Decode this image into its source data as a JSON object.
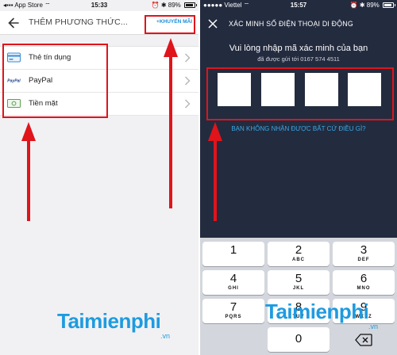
{
  "left": {
    "status": {
      "carrier": "App Store",
      "time": "15:33",
      "battery": "89%"
    },
    "title": "THÊM PHƯƠNG THỨC...",
    "promo": "+KHUYẾN MÃI",
    "methods": [
      {
        "label": "Thẻ tín dụng",
        "icon": "credit-card-icon"
      },
      {
        "label": "PayPal",
        "icon": "paypal-icon"
      },
      {
        "label": "Tiền mặt",
        "icon": "cash-icon"
      }
    ]
  },
  "right": {
    "status": {
      "carrier": "Viettel",
      "time": "15:57",
      "battery": "89%"
    },
    "title": "XÁC MINH SỐ ĐIỆN THOẠI DI ĐỘNG",
    "prompt": "Vui lòng nhập mã xác minh của bạn",
    "sent_to": "đã được gửi tới 0167 574 4511",
    "resend": "BẠN KHÔNG NHẬN ĐƯỢC BẤT CỨ ĐIỀU GÌ?",
    "keys": [
      {
        "d": "1",
        "s": ""
      },
      {
        "d": "2",
        "s": "ABC"
      },
      {
        "d": "3",
        "s": "DEF"
      },
      {
        "d": "4",
        "s": "GHI"
      },
      {
        "d": "5",
        "s": "JKL"
      },
      {
        "d": "6",
        "s": "MNO"
      },
      {
        "d": "7",
        "s": "PQRS"
      },
      {
        "d": "8",
        "s": "TUV"
      },
      {
        "d": "9",
        "s": "WXYZ"
      },
      {
        "d": "0",
        "s": ""
      }
    ]
  },
  "watermark": {
    "name": "Taimienphi",
    "tld": ".vn"
  },
  "colors": {
    "annotation": "#e0141b",
    "accent": "#1a8fd8",
    "dark_bg": "#232b3f"
  }
}
